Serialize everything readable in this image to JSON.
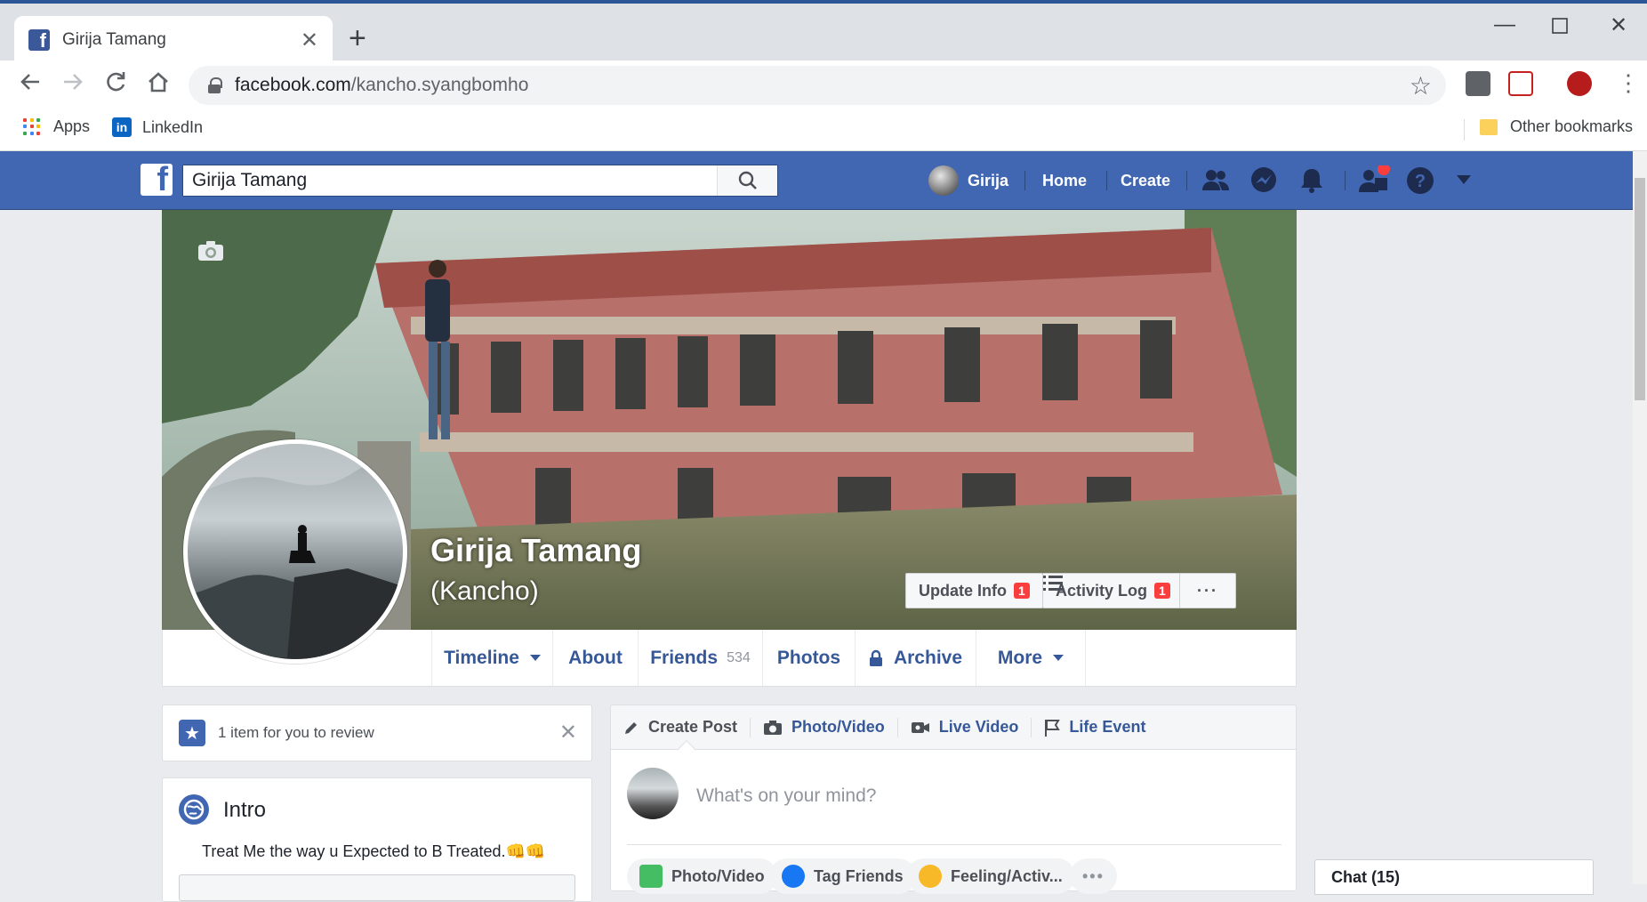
{
  "browser": {
    "tab_title": "Girija Tamang",
    "tab_favicon": "facebook-icon",
    "url_host": "facebook.com",
    "url_path": "/kancho.syangbomho",
    "bookmarks": [
      {
        "label": "Apps",
        "icon": "apps-grid-icon"
      },
      {
        "label": "LinkedIn",
        "icon": "linkedin-icon"
      }
    ],
    "other_bookmarks": "Other bookmarks"
  },
  "fbbar": {
    "search_value": "Girija Tamang",
    "user_name": "Girija",
    "home": "Home",
    "create": "Create",
    "brand_color": "#4267b2"
  },
  "profile": {
    "name": "Girija Tamang",
    "alt_name": "(Kancho)",
    "update_info": "Update Info",
    "update_info_badge": "1",
    "activity_log": "Activity Log",
    "activity_log_badge": "1",
    "more_dots": "···"
  },
  "tabs": {
    "timeline": "Timeline",
    "about": "About",
    "friends": "Friends",
    "friends_count": "534",
    "photos": "Photos",
    "archive": "Archive",
    "more": "More"
  },
  "review": {
    "text": "1 item for you to review"
  },
  "intro": {
    "heading": "Intro",
    "bio": "Treat Me the way u Expected to B Treated.👊👊"
  },
  "composer": {
    "create_post": "Create Post",
    "photo_video": "Photo/Video",
    "live_video": "Live Video",
    "life_event": "Life Event",
    "placeholder": "What's on your mind?",
    "pill_photo": "Photo/Video",
    "pill_tag": "Tag Friends",
    "pill_feeling": "Feeling/Activ...",
    "pill_more": "•••"
  },
  "chat": {
    "label": "Chat (15)"
  }
}
